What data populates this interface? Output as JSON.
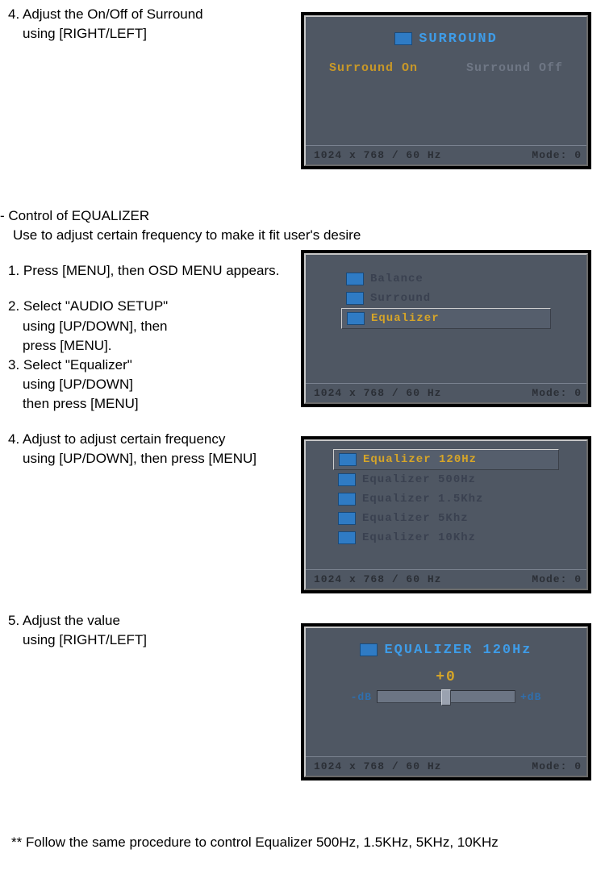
{
  "step4a": {
    "num": "4.",
    "line1": "Adjust the On/Off of Surround",
    "line2": "using [RIGHT/LEFT]"
  },
  "section_eq": {
    "heading": "- Control of EQUALIZER",
    "sub": "Use to adjust certain frequency to make it fit user's desire"
  },
  "step1": {
    "num": "1.",
    "text": "Press [MENU], then OSD MENU appears."
  },
  "step2": {
    "num": "2.",
    "line1": "Select \"AUDIO SETUP\"",
    "line2": "using [UP/DOWN], then",
    "line3": "press  [MENU]."
  },
  "step3": {
    "num": "3.",
    "line1": "Select \"Equalizer\"",
    "line2": "using [UP/DOWN]",
    "line3": "then press  [MENU]"
  },
  "step4b": {
    "num": "4.",
    "line1": "Adjust to adjust certain frequency",
    "line2": "using [UP/DOWN], then press [MENU]"
  },
  "step5": {
    "num": "5.",
    "line1": "Adjust the value",
    "line2": "using [RIGHT/LEFT]"
  },
  "footnote": "** Follow the same procedure to control Equalizer 500Hz, 1.5KHz, 5KHz, 10KHz",
  "osd": {
    "status_left": "1024  x    768  /    60  Hz",
    "status_right": "Mode:    0",
    "surround": {
      "title": "SURROUND",
      "opt_on": "Surround On",
      "opt_off": "Surround Off"
    },
    "menu1": {
      "items": [
        {
          "label": "Balance",
          "selected": false
        },
        {
          "label": "Surround",
          "selected": false
        },
        {
          "label": "Equalizer",
          "selected": true
        }
      ]
    },
    "menu2": {
      "items": [
        {
          "label": "Equalizer 120Hz",
          "selected": true
        },
        {
          "label": "Equalizer 500Hz",
          "selected": false
        },
        {
          "label": "Equalizer 1.5Khz",
          "selected": false
        },
        {
          "label": "Equalizer 5Khz",
          "selected": false
        },
        {
          "label": "Equalizer 10Khz",
          "selected": false
        }
      ]
    },
    "eq_adjust": {
      "title": "EQUALIZER 120Hz",
      "value": "+0",
      "min": "-dB",
      "max": "+dB"
    }
  }
}
